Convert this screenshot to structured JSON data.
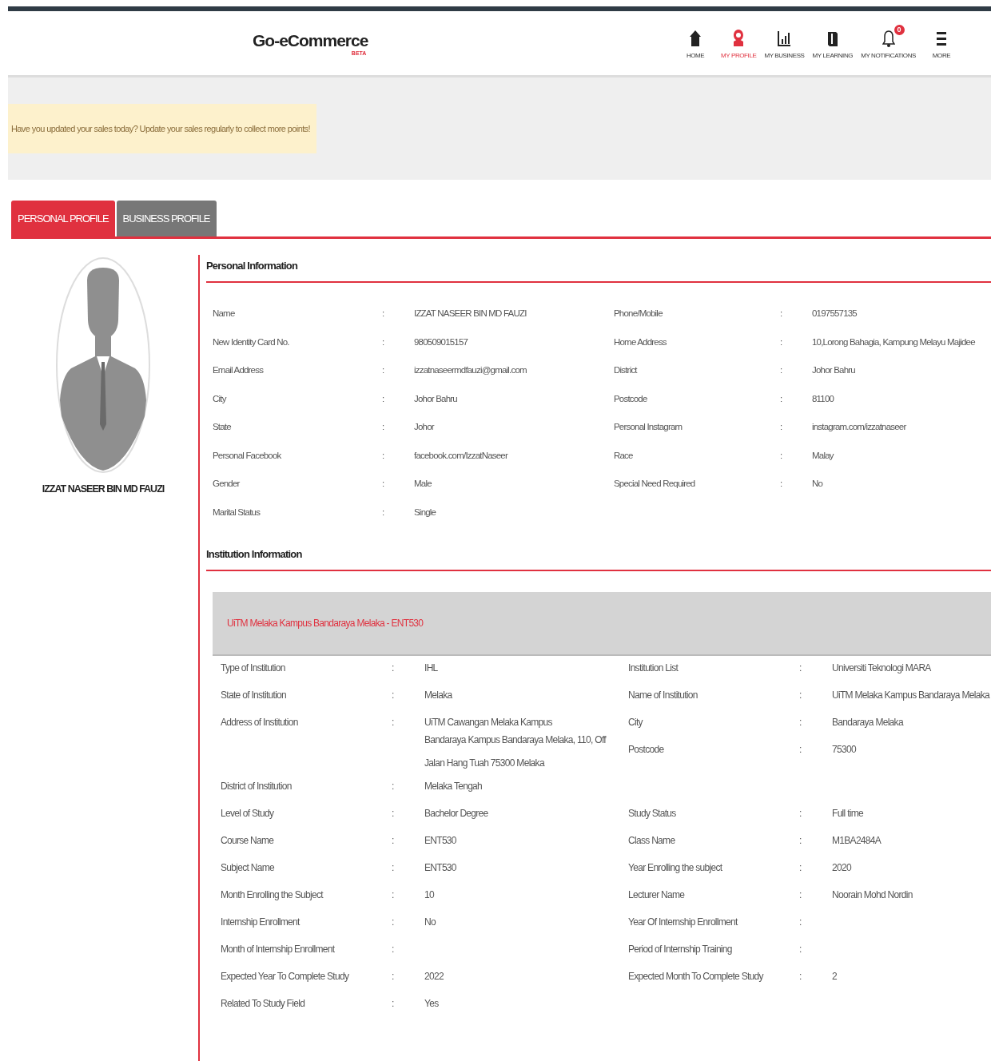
{
  "header": {
    "logo": "Go-eCommerce",
    "logo_badge": "BETA",
    "nav": [
      {
        "kind": "home",
        "label": "HOME",
        "selected": false
      },
      {
        "kind": "profile",
        "label": "MY PROFILE",
        "selected": true
      },
      {
        "kind": "business",
        "label": "MY BUSINESS",
        "selected": false
      },
      {
        "kind": "learning",
        "label": "MY LEARNING",
        "selected": false
      },
      {
        "kind": "notifications",
        "label": "MY NOTIFICATIONS",
        "selected": false,
        "badge": "0"
      },
      {
        "kind": "more",
        "label": "MORE",
        "selected": false
      }
    ]
  },
  "alert": "Have you updated your sales today? Update your sales regularly to collect more points!",
  "tabs": [
    {
      "label": "PERSONAL PROFILE",
      "selected": true
    },
    {
      "label": "BUSINESS PROFILE",
      "selected": false
    }
  ],
  "profile_name": "IZZAT NASEER BIN MD FAUZI",
  "personal": {
    "title": "Personal Information",
    "rows": [
      {
        "left": {
          "label": "Name",
          "value": "IZZAT NASEER BIN MD FAUZI"
        },
        "right": {
          "label": "Phone/Mobile",
          "value": "0197557135"
        }
      },
      {
        "left": {
          "label": "New Identity Card No.",
          "value": "980509015157"
        },
        "right": {
          "label": "Home Address",
          "value": "10,Lorong Bahagia, Kampung Melayu Majidee"
        }
      },
      {
        "left": {
          "label": "Email Address",
          "value": "izzatnaseermdfauzi@gmail.com"
        },
        "right": {
          "label": "District",
          "value": "Johor Bahru"
        }
      },
      {
        "left": {
          "label": "City",
          "value": "Johor Bahru"
        },
        "right": {
          "label": "Postcode",
          "value": "81100"
        }
      },
      {
        "left": {
          "label": "State",
          "value": "Johor"
        },
        "right": {
          "label": "Personal Instagram",
          "value": "instagram.com/izzatnaseer"
        }
      },
      {
        "left": {
          "label": "Personal Facebook",
          "value": "facebook.com/IzzatNaseer"
        },
        "right": {
          "label": "Race",
          "value": "Malay"
        }
      },
      {
        "left": {
          "label": "Gender",
          "value": "Male"
        },
        "right": {
          "label": "Special Need Required",
          "value": "No"
        }
      },
      {
        "left": {
          "label": "Marital Status",
          "value": "Single"
        }
      }
    ]
  },
  "institution": {
    "title": "Institution Information",
    "banner": "UiTM Melaka Kampus Bandaraya Melaka - ENT530",
    "rows": [
      {
        "left": [
          {
            "label": "Type of Institution",
            "value": [
              "IHL"
            ]
          }
        ],
        "right": [
          {
            "label": "Institution List",
            "value": [
              "Universiti Teknologi MARA"
            ]
          }
        ]
      },
      {
        "left": [
          {
            "label": "State of Institution",
            "value": [
              "Melaka"
            ]
          }
        ],
        "right": [
          {
            "label": "Name of Institution",
            "value": [
              "UiTM Melaka Kampus Bandaraya Melaka"
            ]
          }
        ]
      },
      {
        "left": [
          {
            "label": "Address of Institution",
            "value": [
              "UiTM Cawangan Melaka Kampus",
              "Bandaraya Kampus Bandaraya Melaka, 110, Off",
              "Jalan Hang Tuah 75300 Melaka"
            ]
          }
        ],
        "right": [
          {
            "label": "City",
            "value": [
              "Bandaraya Melaka"
            ]
          },
          {
            "label": "Postcode",
            "value": [
              "75300"
            ]
          }
        ]
      },
      {
        "left": [
          {
            "label": "District of Institution",
            "value": [
              "Melaka Tengah"
            ]
          }
        ]
      },
      {
        "left": [
          {
            "label": "Level of Study",
            "value": [
              "Bachelor Degree"
            ]
          }
        ],
        "right": [
          {
            "label": "Study Status",
            "value": [
              "Full time"
            ]
          }
        ]
      },
      {
        "left": [
          {
            "label": "Course Name",
            "value": [
              "ENT530"
            ]
          }
        ],
        "right": [
          {
            "label": "Class Name",
            "value": [
              "M1BA2484A"
            ]
          }
        ]
      },
      {
        "left": [
          {
            "label": "Subject Name",
            "value": [
              "ENT530"
            ]
          }
        ],
        "right": [
          {
            "label": "Year Enrolling the subject",
            "value": [
              "2020"
            ]
          }
        ]
      },
      {
        "left": [
          {
            "label": "Month Enrolling the Subject",
            "value": [
              "10"
            ]
          }
        ],
        "right": [
          {
            "label": "Lecturer Name",
            "value": [
              "Noorain Mohd Nordin"
            ]
          }
        ]
      },
      {
        "left": [
          {
            "label": "Internship Enrollment",
            "value": [
              "No"
            ]
          }
        ],
        "right": [
          {
            "label": "Year Of Internship Enrollment"
          }
        ]
      },
      {
        "left": [
          {
            "label": "Month of Internship Enrollment"
          }
        ],
        "right": [
          {
            "label": "Period of Internship Training"
          }
        ]
      },
      {
        "left": [
          {
            "label": "Expected Year To Complete Study",
            "value": [
              "2022"
            ]
          }
        ],
        "right": [
          {
            "label": "Expected Month To Complete Study",
            "value": [
              "2"
            ]
          }
        ]
      },
      {
        "left": [
          {
            "label": "Related To Study Field",
            "value": [
              "Yes"
            ]
          }
        ]
      }
    ]
  },
  "separator": ":"
}
